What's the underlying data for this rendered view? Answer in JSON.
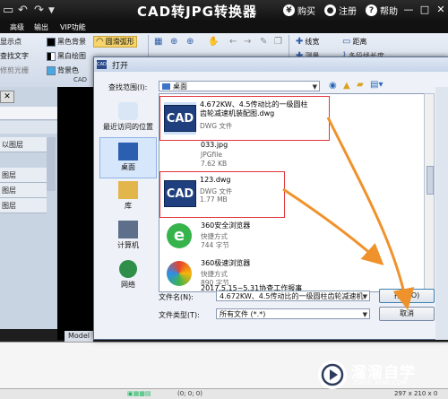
{
  "app": {
    "title": "CAD转JPG转换器",
    "top_links": {
      "buy": "购买",
      "register": "注册",
      "help": "帮助"
    },
    "window_buttons": {
      "minimize": "—",
      "maximize": "□",
      "close": "✕"
    }
  },
  "menu": {
    "tabs": [
      "高级",
      "输出",
      "VIP功能"
    ]
  },
  "ribbon": {
    "left_cut": [
      "显示点",
      "查找文字",
      "修剪光栅"
    ],
    "col1": [
      "黑色背景",
      "黑白绘图",
      "背景色"
    ],
    "col2": [
      "圆滑弧形"
    ],
    "group_label": "CAD",
    "right": [
      "线宽",
      "距离",
      "测量",
      "多段线长度"
    ]
  },
  "left_panel": {
    "rows": [
      "以图层",
      "图层",
      "图层",
      "图层"
    ]
  },
  "model_tab": "Model",
  "dialog": {
    "title": "打开",
    "lookin_label": "查找范围(I):",
    "lookin_value": "桌面",
    "places": [
      {
        "label": "最近访问的位置"
      },
      {
        "label": "桌面"
      },
      {
        "label": "库"
      },
      {
        "label": "计算机"
      },
      {
        "label": "网络"
      }
    ],
    "files": [
      {
        "name": "4.672KW、4.5传动比的一级圆柱齿轮减速机装配图.dwg",
        "name_l1": "4.672KW、4.5传动比的一级圆柱",
        "name_l2": "齿轮减速机装配图.dwg",
        "type": "DWG 文件",
        "size": ""
      },
      {
        "name": "033.jpg",
        "type": "JPGfile",
        "size": "7.62 KB"
      },
      {
        "name": "123.dwg",
        "type": "DWG 文件",
        "size": "1.77 MB"
      },
      {
        "name": "360安全浏览器",
        "type": "快捷方式",
        "size": "744 字节"
      },
      {
        "name": "360极速浏览器",
        "type": "快捷方式",
        "size": "890 字节"
      },
      {
        "name": "2017.5.15~5.31协查工作报事",
        "type": "",
        "size": ""
      }
    ],
    "filename_label": "文件名(N):",
    "filename_value": "4.672KW、4.5传动比的一级圆柱齿轮减速机",
    "filetype_label": "文件类型(T):",
    "filetype_value": "所有文件 (*.*)",
    "open_button": "打开(O)",
    "cancel_button": "取消"
  },
  "status": {
    "coords": "(0; 0; 0)",
    "size": "297 x 210 x 0"
  },
  "watermark": {
    "title": "溜溜自学",
    "subtitle": "ZIXUE.3066.COM"
  }
}
